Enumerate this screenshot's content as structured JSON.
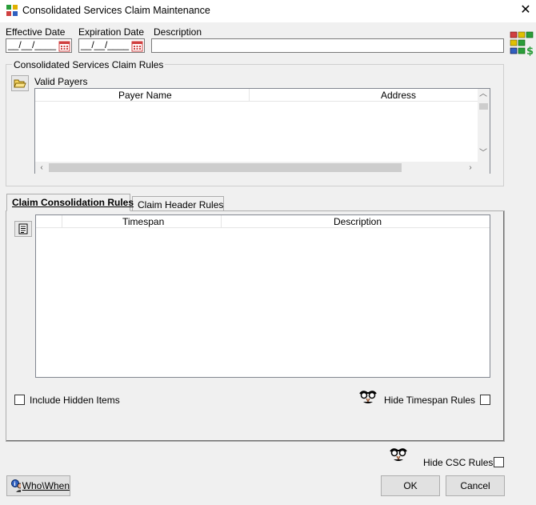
{
  "window": {
    "title": "Consolidated Services Claim Maintenance",
    "close_glyph": "✕",
    "app_icon": "csc-app-icon"
  },
  "header": {
    "effective_date_label": "Effective Date",
    "effective_date_value": "__/__/____",
    "expiration_date_label": "Expiration Date",
    "expiration_date_value": "__/__/____",
    "description_label": "Description",
    "description_value": ""
  },
  "rules_group": {
    "title": "Consolidated Services Claim Rules",
    "valid_payers_label": "Valid Payers",
    "columns": [
      "Payer Name",
      "Address"
    ],
    "rows": []
  },
  "tabs": [
    {
      "label": "Claim Consolidation Rules",
      "active": true
    },
    {
      "label": "Claim Header Rules",
      "active": false
    }
  ],
  "consolidation": {
    "columns": [
      "Timespan",
      "Description"
    ],
    "rows": [],
    "include_hidden_label": "Include Hidden Items",
    "hide_timespan_label": "Hide Timespan Rules"
  },
  "footer": {
    "hide_csc_label": "Hide CSC Rules",
    "who_when_label": "Who\\When",
    "ok_label": "OK",
    "cancel_label": "Cancel"
  },
  "colors": {
    "window_bg": "#f0f0f0",
    "field_border": "#7a7a7a",
    "calendar_red": "#d04040"
  }
}
